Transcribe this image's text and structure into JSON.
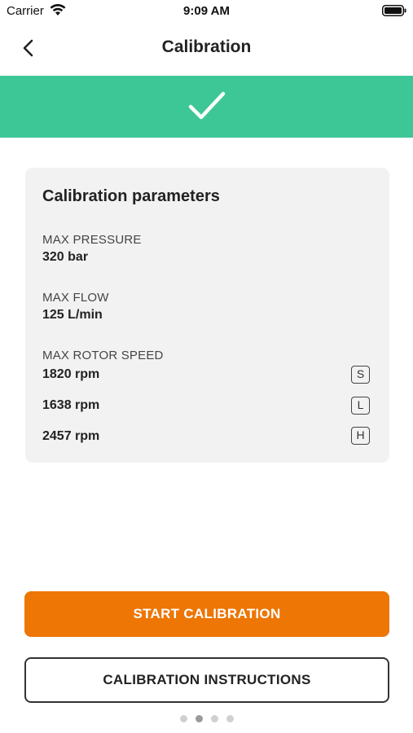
{
  "status_bar": {
    "carrier": "Carrier",
    "time": "9:09 AM"
  },
  "nav": {
    "title": "Calibration"
  },
  "colors": {
    "banner": "#3ec796",
    "primary_button": "#ed7605",
    "card_bg": "#f2f2f2"
  },
  "card": {
    "title": "Calibration parameters",
    "max_pressure": {
      "label": "MAX PRESSURE",
      "value": "320 bar"
    },
    "max_flow": {
      "label": "MAX FLOW",
      "value": "125 L/min"
    },
    "max_rotor_speed": {
      "label": "MAX ROTOR SPEED",
      "rows": [
        {
          "value": "1820 rpm",
          "badge": "S"
        },
        {
          "value": "1638 rpm",
          "badge": "L"
        },
        {
          "value": "2457 rpm",
          "badge": "H"
        }
      ]
    }
  },
  "buttons": {
    "start": "START CALIBRATION",
    "instructions": "CALIBRATION INSTRUCTIONS"
  },
  "pager": {
    "total": 4,
    "active_index": 1
  }
}
